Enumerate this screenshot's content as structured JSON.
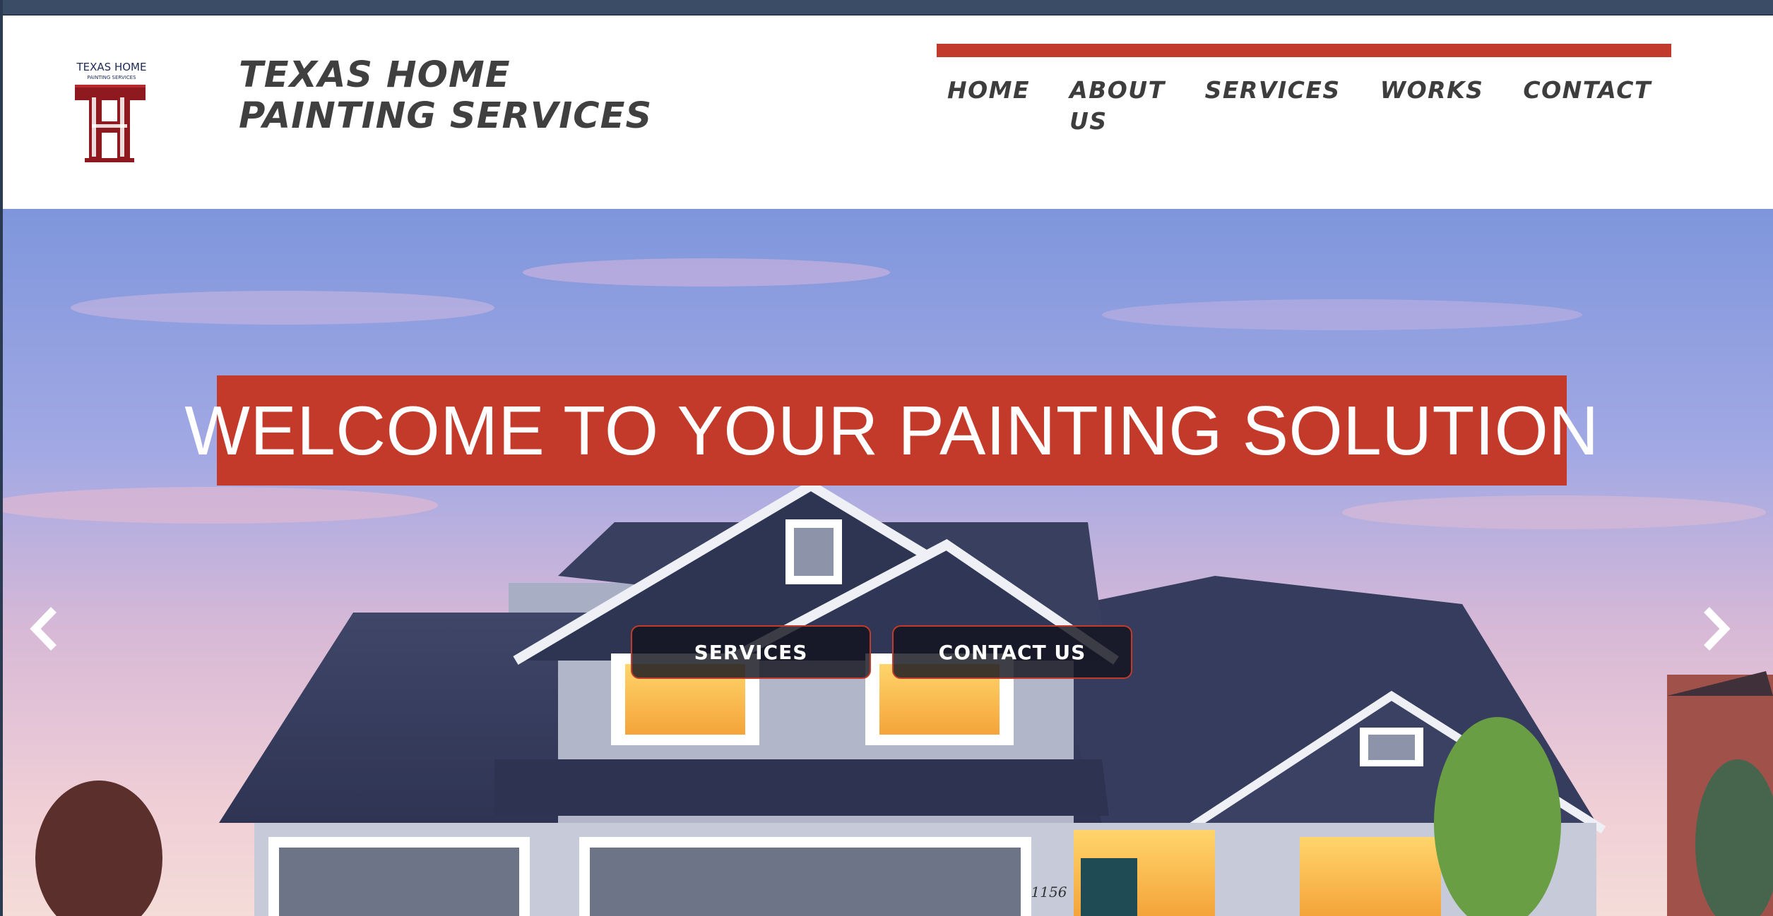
{
  "brand": {
    "line1": "TEXAS HOME",
    "line2": "PAINTING SERVICES",
    "logo_text_top": "TEXAS HOME",
    "logo_text_sub": "PAINTING SERVICES",
    "logo_letter": "H",
    "logo_letter_back": "T"
  },
  "nav": {
    "items": [
      {
        "label": "HOME"
      },
      {
        "label": "ABOUT US"
      },
      {
        "label": "SERVICES"
      },
      {
        "label": "WORKS"
      },
      {
        "label": "CONTACT"
      }
    ]
  },
  "hero": {
    "headline": "WELCOME TO YOUR PAINTING SOLUTION",
    "buttons": {
      "services_label": "SERVICES",
      "contact_label": "CONTACT US"
    },
    "house_number": "1156",
    "prev_icon": "chevron-left-icon",
    "next_icon": "chevron-right-icon"
  },
  "colors": {
    "accent": "#c43a2a",
    "top_strip": "#3b4d66",
    "nav_text": "#3d3d3d"
  }
}
